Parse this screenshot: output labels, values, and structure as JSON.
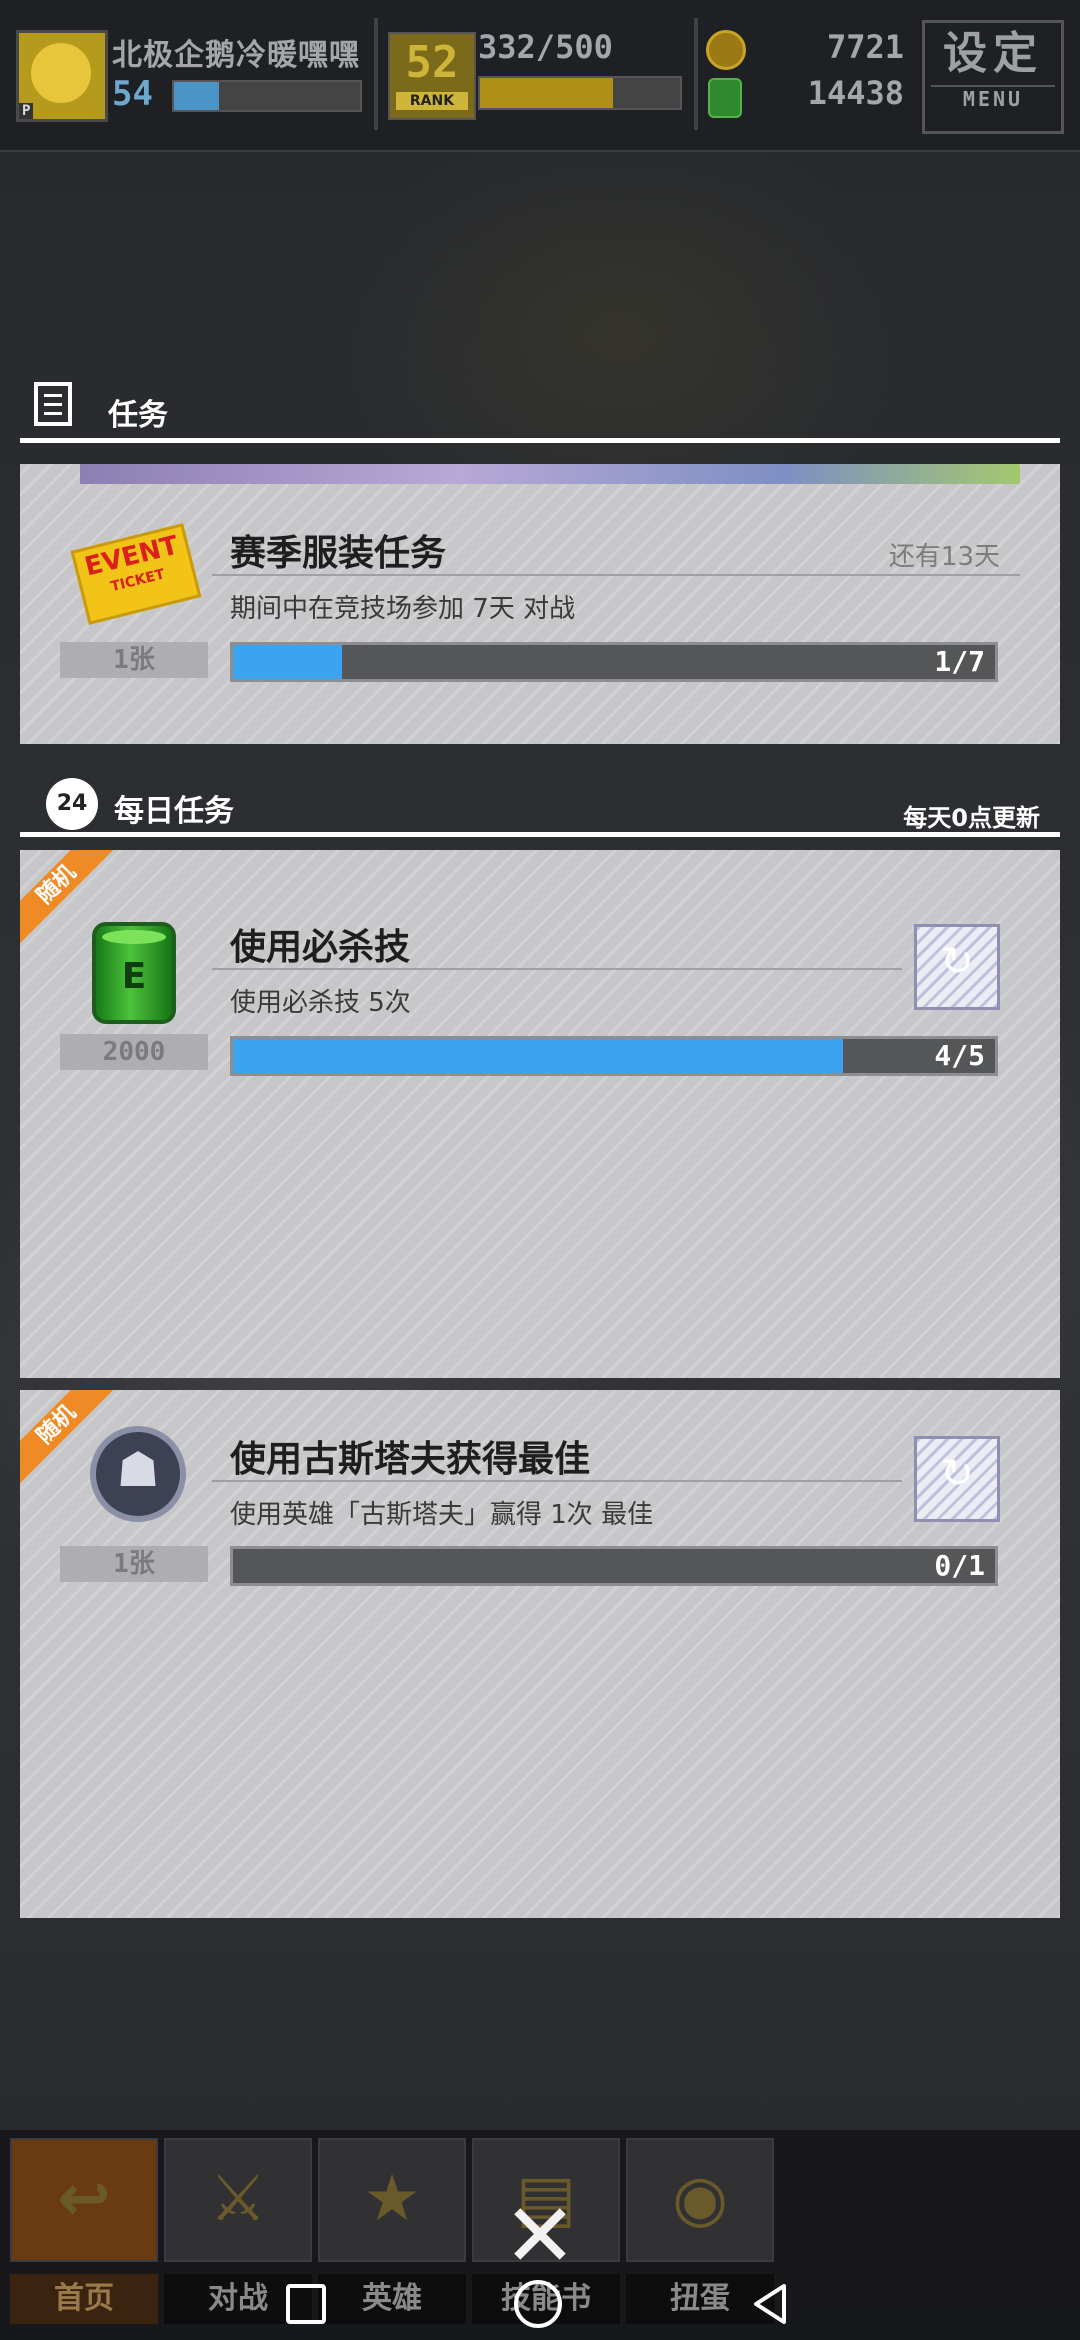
{
  "hud": {
    "player_name": "北极企鹅冷暖嘿嘿",
    "player_level": "54",
    "level_progress": 0.24,
    "rank_number": "52",
    "rank_label": "RANK",
    "rank_exp": "332/500",
    "rank_progress": 0.664,
    "coins": "7721",
    "energy": "14438",
    "menu_main": "设定",
    "menu_sub": "MENU"
  },
  "missions_section": {
    "title": "任务",
    "items": [
      {
        "title": "赛季服装任务",
        "remaining": "还有13天",
        "description": "期间中在竞技场参加 7天 对战",
        "reward_qty": "1张",
        "reward_icon": "event-ticket-icon",
        "ticket_line1": "EVENT",
        "ticket_line2": "TICKET",
        "progress_text": "1/7",
        "progress": 0.143
      }
    ]
  },
  "daily_section": {
    "title": "每日任务",
    "clock_label": "24",
    "refresh_note": "每天0点更新",
    "items": [
      {
        "tag": "随机",
        "title": "使用必杀技",
        "description": "使用必杀技 5次",
        "reward_qty": "2000",
        "reward_icon": "energy-drum-icon",
        "progress_text": "4/5",
        "progress": 0.8
      },
      {
        "tag": "随机",
        "title": "使用古斯塔夫获得最佳",
        "description": "使用英雄「古斯塔夫」赢得 1次 最佳",
        "reward_qty": "1张",
        "reward_icon": "hero-emblem-icon",
        "progress_text": "0/1",
        "progress": 0
      }
    ]
  },
  "bottom_nav": {
    "tabs": [
      "首页",
      "对战",
      "英雄",
      "技能书",
      "扭蛋"
    ]
  },
  "colors": {
    "progress_fill": "#3ba3f0",
    "random_tag": "#f08a24",
    "card_bg": "#c7c7c9"
  }
}
